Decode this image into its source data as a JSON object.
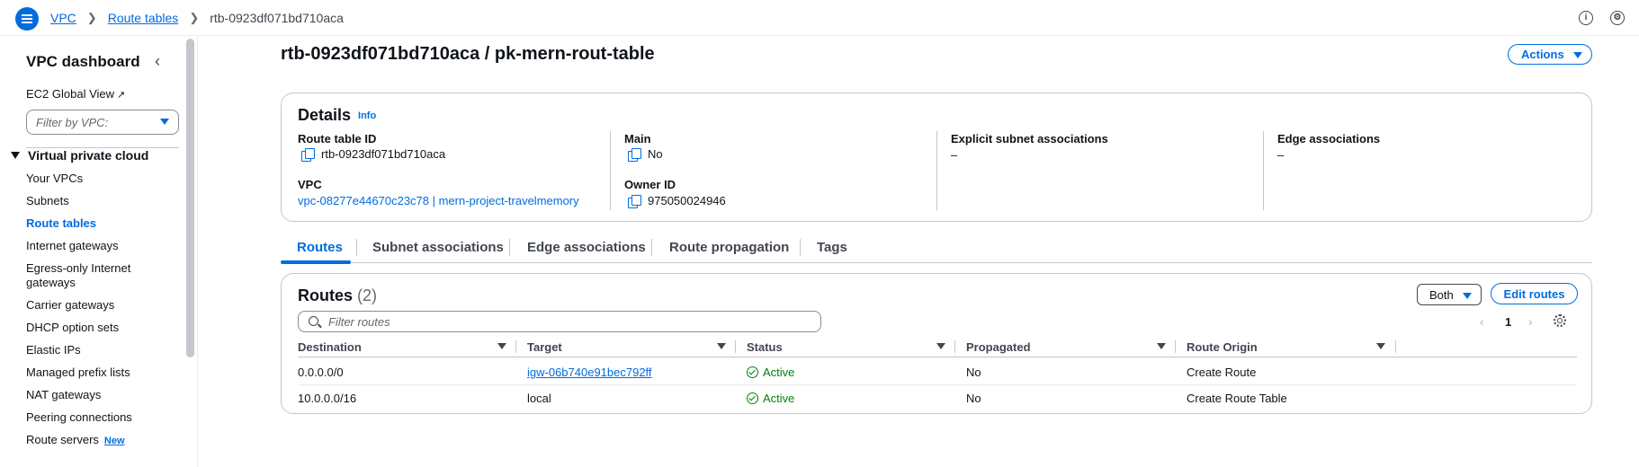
{
  "breadcrumb": {
    "vpc": "VPC",
    "route_tables": "Route tables",
    "current": "rtb-0923df071bd710aca"
  },
  "sidebar": {
    "title": "VPC dashboard",
    "ec2_global_view": "EC2 Global View",
    "filter_placeholder": "Filter by VPC:",
    "section": "Virtual private cloud",
    "items": [
      {
        "label": "Your VPCs"
      },
      {
        "label": "Subnets"
      },
      {
        "label": "Route tables"
      },
      {
        "label": "Internet gateways"
      },
      {
        "label": "Egress-only Internet gateways"
      },
      {
        "label": "Carrier gateways"
      },
      {
        "label": "DHCP option sets"
      },
      {
        "label": "Elastic IPs"
      },
      {
        "label": "Managed prefix lists"
      },
      {
        "label": "NAT gateways"
      },
      {
        "label": "Peering connections"
      },
      {
        "label": "Route servers",
        "badge": "New"
      }
    ]
  },
  "page": {
    "title": "rtb-0923df071bd710aca / pk-mern-rout-table",
    "actions_label": "Actions"
  },
  "details": {
    "title": "Details",
    "info": "Info",
    "route_table_id_label": "Route table ID",
    "route_table_id": "rtb-0923df071bd710aca",
    "vpc_label": "VPC",
    "vpc_value": "vpc-08277e44670c23c78 | mern-project-travelmemory",
    "main_label": "Main",
    "main_value": "No",
    "owner_id_label": "Owner ID",
    "owner_id": "975050024946",
    "explicit_label": "Explicit subnet associations",
    "explicit_value": "–",
    "edge_label": "Edge associations",
    "edge_value": "–"
  },
  "tabs": [
    {
      "label": "Routes"
    },
    {
      "label": "Subnet associations"
    },
    {
      "label": "Edge associations"
    },
    {
      "label": "Route propagation"
    },
    {
      "label": "Tags"
    }
  ],
  "routes": {
    "title": "Routes",
    "count": "(2)",
    "both_label": "Both",
    "edit_label": "Edit routes",
    "filter_placeholder": "Filter routes",
    "page": "1",
    "columns": [
      "Destination",
      "Target",
      "Status",
      "Propagated",
      "Route Origin"
    ],
    "rows": [
      {
        "destination": "0.0.0.0/0",
        "target": "igw-06b740e91bec792ff",
        "status": "Active",
        "propagated": "No",
        "origin": "Create Route"
      },
      {
        "destination": "10.0.0.0/16",
        "target": "local",
        "status": "Active",
        "propagated": "No",
        "origin": "Create Route Table"
      }
    ]
  },
  "colors": {
    "accent": "#006ce0",
    "success": "#037f0c",
    "text": "#0f141a"
  }
}
